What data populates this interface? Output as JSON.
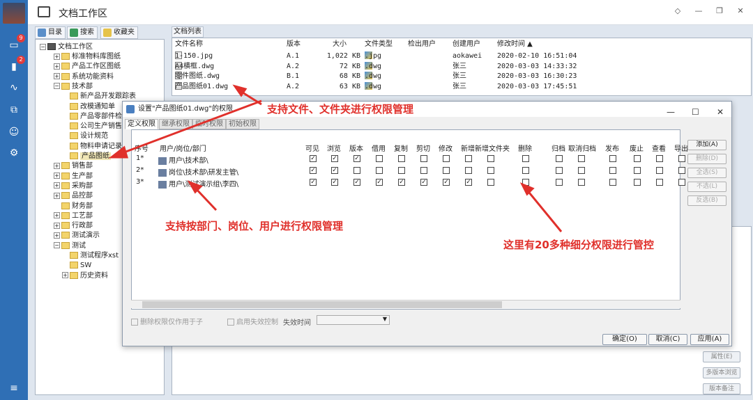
{
  "leftbar": {
    "badges": [
      "9",
      "2"
    ]
  },
  "window": {
    "title": "文档工作区",
    "buttons": [
      "◇",
      "—",
      "❐",
      "✕"
    ]
  },
  "tabs": [
    {
      "label": "目录"
    },
    {
      "label": "搜索"
    },
    {
      "label": "收藏夹"
    }
  ],
  "tree": {
    "root": "文档工作区",
    "items": [
      "标准物料库图纸",
      "产品工作区图纸",
      "系统功能资料",
      "技术部",
      "新产品开发跟踪表",
      "改模通知单",
      "产品零部件检验",
      "公司生产销售",
      "设计规范",
      "物料申请记录",
      "产品图纸",
      "销售部",
      "生产部",
      "采购部",
      "品控部",
      "财务部",
      "工艺部",
      "行政部",
      "测试演示",
      "测试",
      "测试程序xst",
      "SW",
      "历史资料"
    ]
  },
  "doclist": {
    "tab": "文档列表",
    "headers": [
      "文件名称",
      "版本",
      "大小",
      "文件类型",
      "检出用户",
      "创建用户",
      "修改时间 ▲"
    ],
    "rows": [
      {
        "name": "1-150.jpg",
        "ver": "A.1",
        "size": "1,022 KB",
        "type": ".jpg",
        "checkout": "",
        "creator": "aokawei",
        "time": "2020-02-10 16:51:04"
      },
      {
        "name": "A4横框.dwg",
        "ver": "A.2",
        "size": "72 KB",
        "type": ".dwg",
        "checkout": "",
        "creator": "张三",
        "time": "2020-03-03 14:33:32"
      },
      {
        "name": "零件图纸.dwg",
        "ver": "B.1",
        "size": "68 KB",
        "type": ".dwg",
        "checkout": "",
        "creator": "张三",
        "time": "2020-03-03 16:30:23"
      },
      {
        "name": "产品图纸01.dwg",
        "ver": "A.2",
        "size": "63 KB",
        "type": ".dwg",
        "checkout": "",
        "creator": "张三",
        "time": "2020-03-03 17:45:51"
      }
    ]
  },
  "dialog": {
    "title": "设置\"产品图纸01.dwg\"的权限",
    "tabs": [
      "定义权限",
      "继承权限",
      "临时权限",
      "初始权限"
    ],
    "headers": [
      "序号",
      "用户/岗位/部门",
      "可见",
      "浏览",
      "版本",
      "借用",
      "复制",
      "剪切",
      "修改",
      "新增",
      "新增文件夹",
      "删除",
      "归档",
      "取消归档",
      "发布",
      "废止",
      "查看",
      "导出"
    ],
    "rows": [
      {
        "n": "1*",
        "who": "用户\\技术部\\",
        "checks": [
          1,
          1,
          1,
          0,
          0,
          0,
          0,
          0,
          0,
          0,
          0,
          0,
          0,
          0,
          0,
          0
        ]
      },
      {
        "n": "2*",
        "who": "岗位\\技术部\\研发主管\\",
        "checks": [
          1,
          1,
          0,
          0,
          0,
          0,
          0,
          0,
          0,
          0,
          0,
          0,
          0,
          0,
          0,
          0
        ]
      },
      {
        "n": "3*",
        "who": "用户\\测试演示组\\李四\\",
        "checks": [
          1,
          1,
          1,
          1,
          1,
          1,
          1,
          1,
          0,
          0,
          0,
          0,
          0,
          0,
          0,
          0
        ]
      }
    ],
    "side": [
      "添加(A)",
      "删除(D)",
      "全选(S)",
      "不选(L)",
      "反选(B)"
    ],
    "opt1": "删除权限仅作用于子",
    "opt2": "启用失效控制",
    "expire": "失效时间",
    "ok": "确定(O)",
    "cancel": "取消(C)",
    "apply": "应用(A)"
  },
  "right_buttons": [
    "属性(E)",
    "多版本浏览",
    "版本备注"
  ],
  "annotations": [
    "支持文件、文件夹进行权限管理",
    "支持按部门、岗位、用户进行权限管理",
    "这里有20多种细分权限进行管控"
  ],
  "colors": {
    "accent": "#2f6fb5",
    "annotation": "#e0302b"
  }
}
